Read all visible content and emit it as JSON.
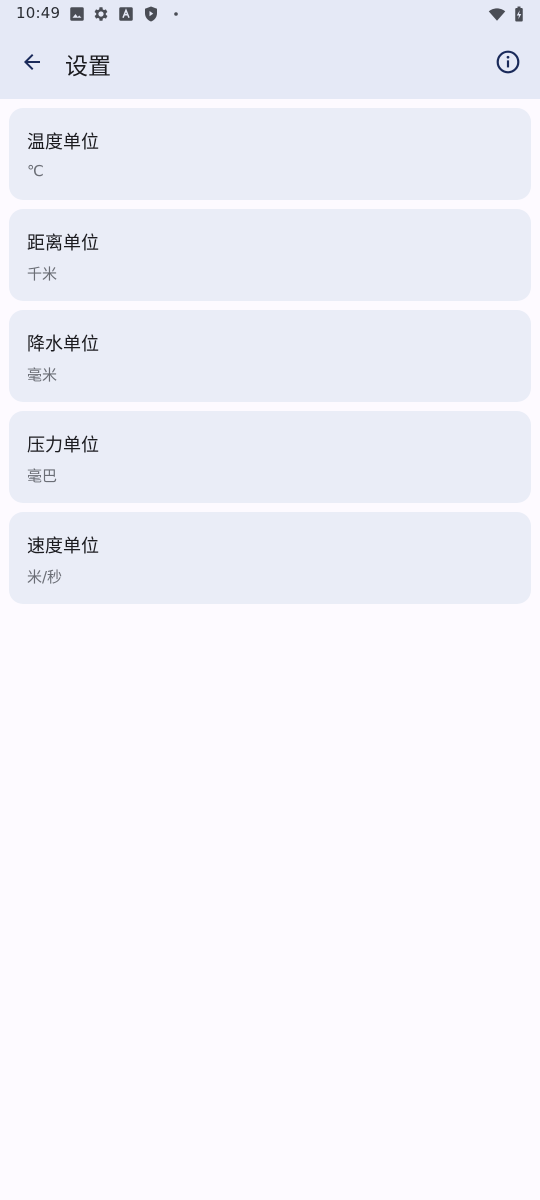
{
  "status_bar": {
    "time": "10:49",
    "left_icons": [
      "image-icon",
      "gear-icon",
      "font-a-icon",
      "shield-play-icon",
      "dot-icon"
    ],
    "right_icons": [
      "wifi-icon",
      "battery-charging-icon"
    ]
  },
  "app_bar": {
    "title": "设置",
    "back_icon": "arrow-back-icon",
    "info_icon": "info-icon"
  },
  "settings": [
    {
      "label": "温度单位",
      "value": "℃"
    },
    {
      "label": "距离单位",
      "value": "千米"
    },
    {
      "label": "降水单位",
      "value": "毫米"
    },
    {
      "label": "压力单位",
      "value": "毫巴"
    },
    {
      "label": "速度单位",
      "value": "米/秒"
    }
  ],
  "colors": {
    "app_bar_bg": "#e5e9f6",
    "card_bg": "#eaedf7",
    "page_bg": "#fdfaff",
    "icon_dark": "#1a2a5a"
  }
}
